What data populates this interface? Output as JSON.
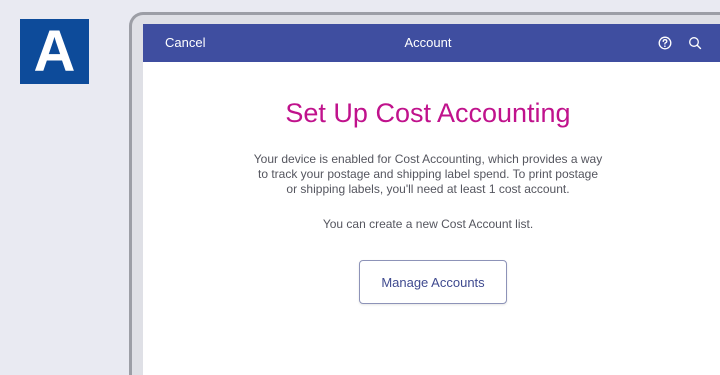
{
  "step": {
    "letter": "A",
    "color": "#0d4b9a"
  },
  "appbar": {
    "cancel_label": "Cancel",
    "title": "Account",
    "color": "#3f4ea0",
    "icons": [
      "help-icon",
      "search-icon"
    ]
  },
  "content": {
    "heading": "Set Up Cost Accounting",
    "heading_color": "#c0128c",
    "description": "Your device is enabled for Cost Accounting, which provides a way to track your postage and shipping label spend. To print postage or shipping labels, you'll need at least 1 cost account.",
    "create_note": "You can create a new Cost Account list.",
    "manage_button_label": "Manage  Accounts"
  }
}
